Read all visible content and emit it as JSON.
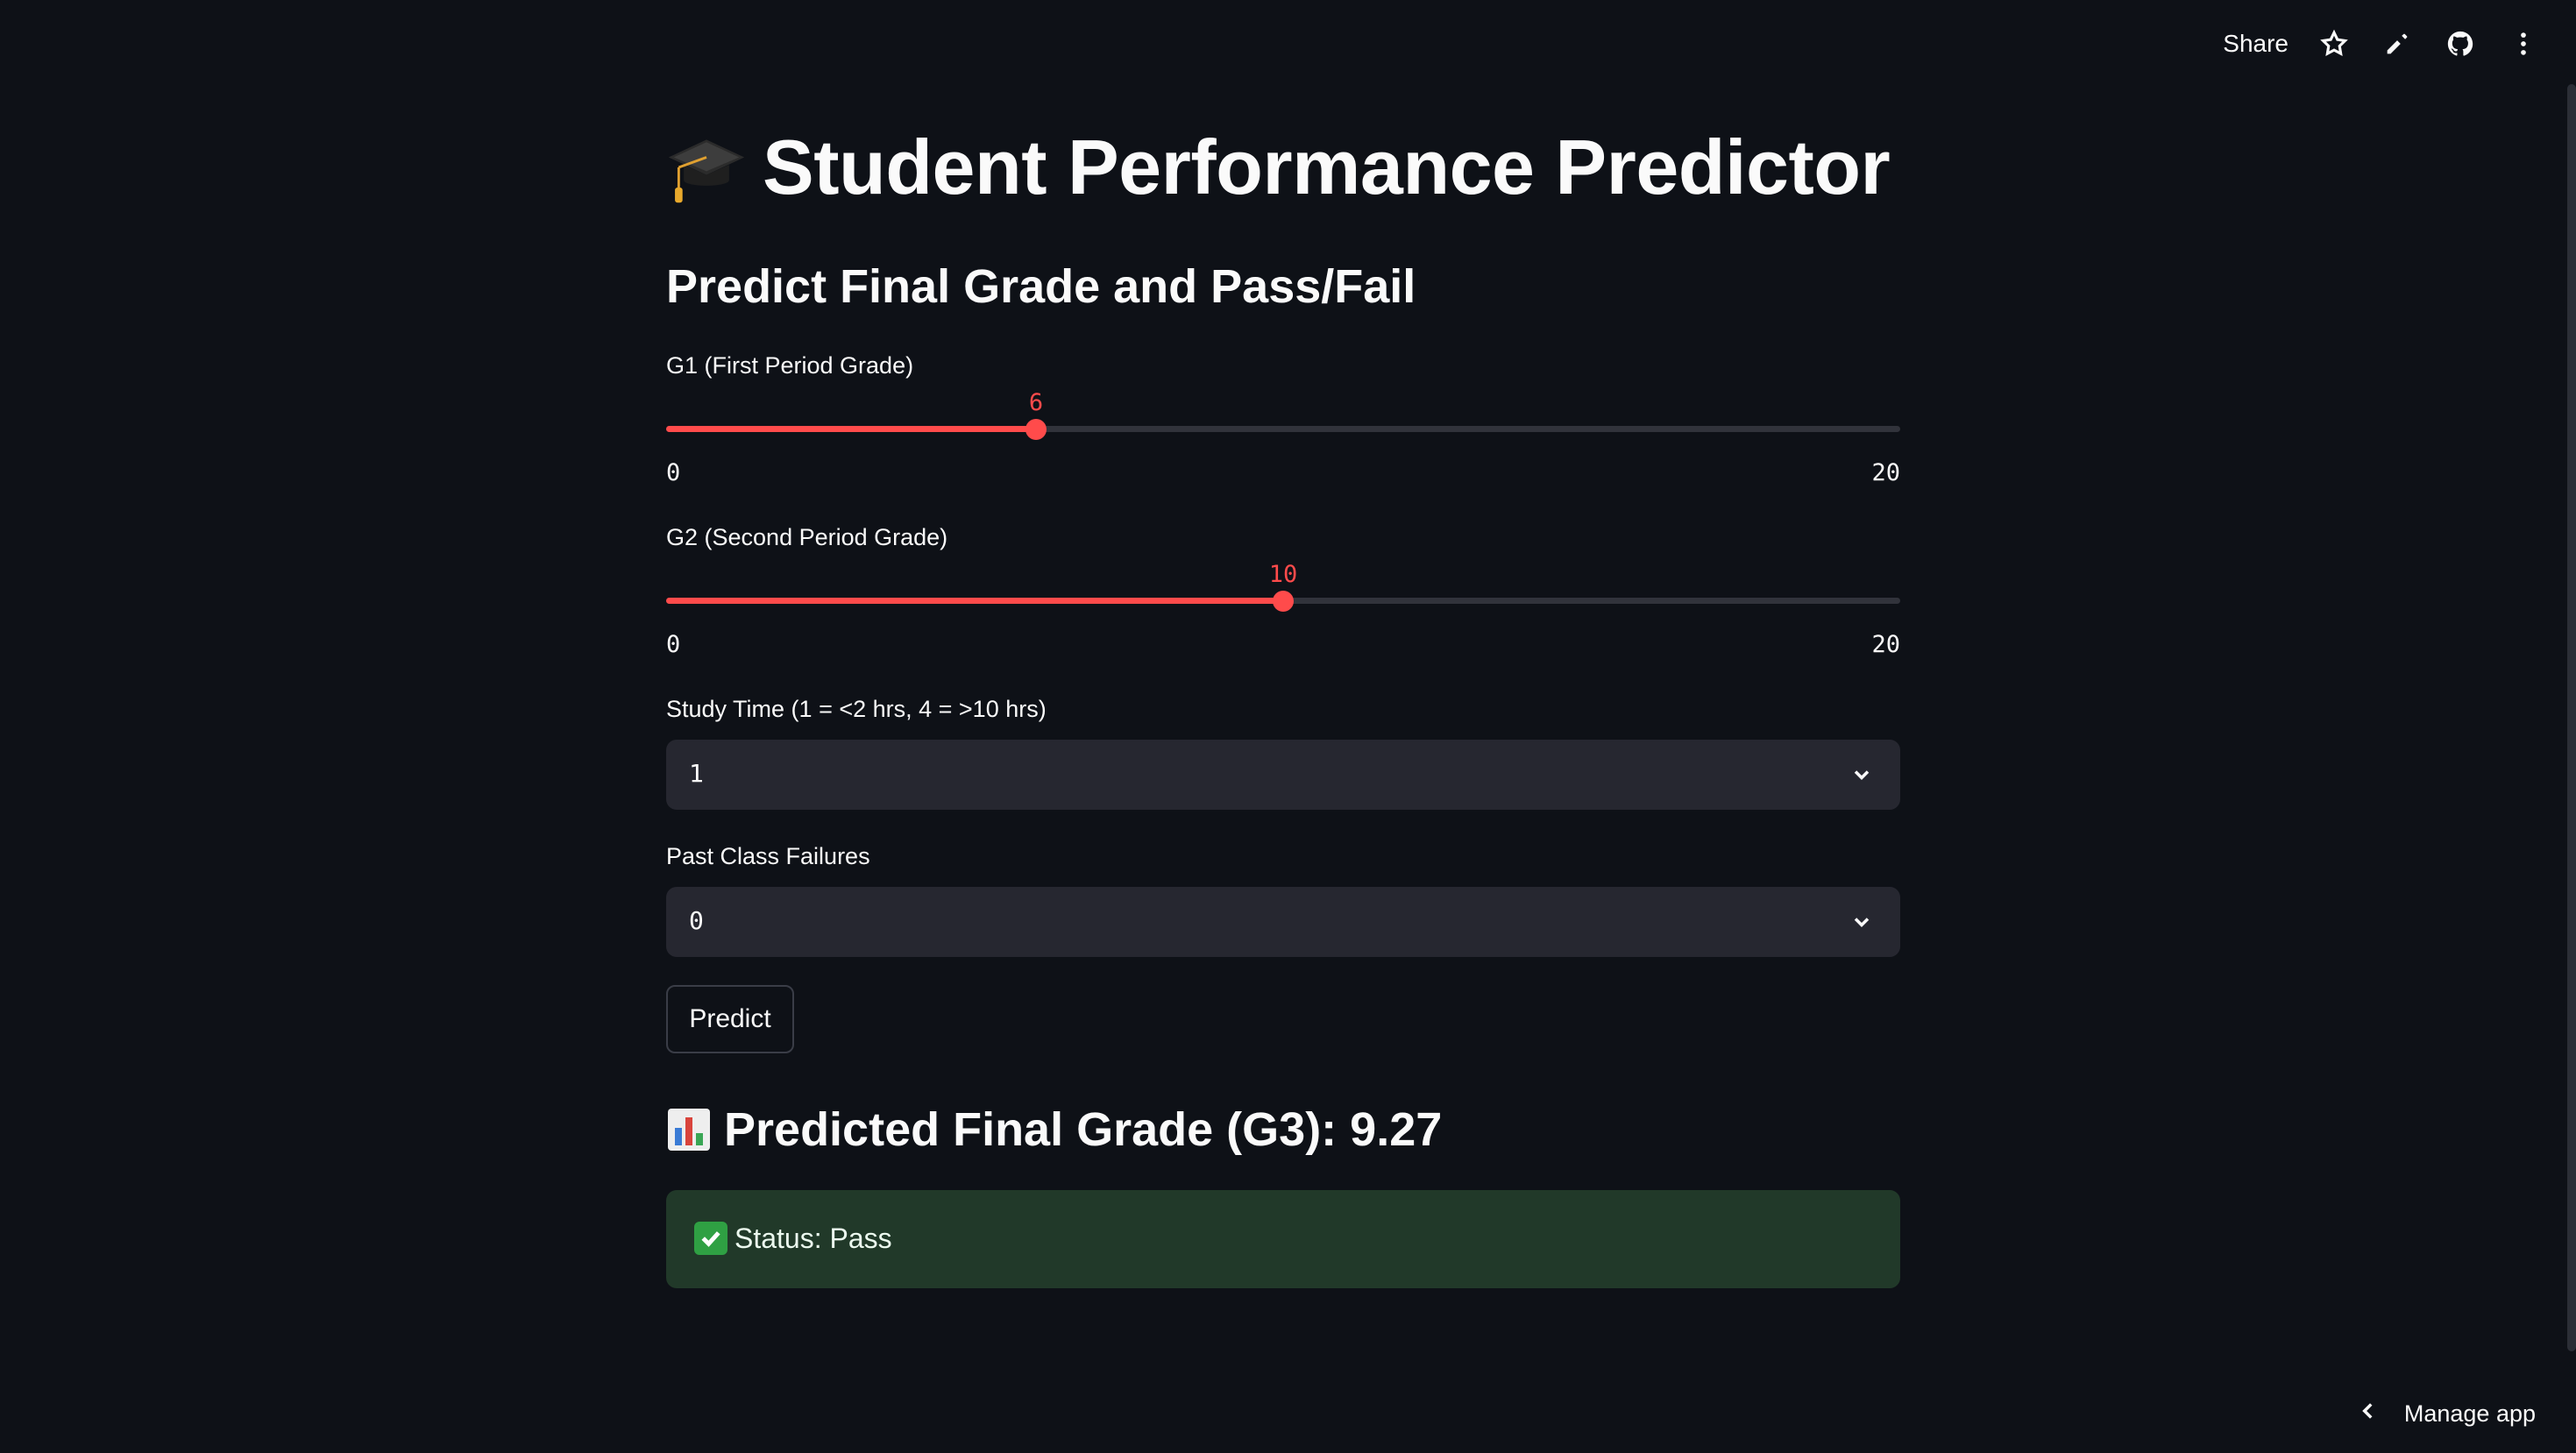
{
  "toolbar": {
    "share_label": "Share",
    "icons": [
      "star-icon",
      "pencil-icon",
      "github-icon",
      "more-vertical-icon"
    ]
  },
  "header": {
    "title": "Student Performance Predictor",
    "title_icon": "graduation-cap-icon",
    "subtitle": "Predict Final Grade and Pass/Fail"
  },
  "form": {
    "g1": {
      "label": "G1 (First Period Grade)",
      "value": "6",
      "min": "0",
      "max": "20"
    },
    "g2": {
      "label": "G2 (Second Period Grade)",
      "value": "10",
      "min": "0",
      "max": "20"
    },
    "studytime": {
      "label": "Study Time (1 = <2 hrs, 4 = >10 hrs)",
      "value": "1"
    },
    "failures": {
      "label": "Past Class Failures",
      "value": "0"
    },
    "predict_label": "Predict"
  },
  "result": {
    "icon": "bar-chart-icon",
    "heading": "Predicted Final Grade (G3): 9.27",
    "status_icon": "check-mark-icon",
    "status_text": "Status: Pass"
  },
  "footer": {
    "manage_label": "Manage app"
  },
  "colors": {
    "background": "#0e1117",
    "accent": "#ff4b4b",
    "input_bg": "#262730",
    "success_bg": "#213929"
  }
}
